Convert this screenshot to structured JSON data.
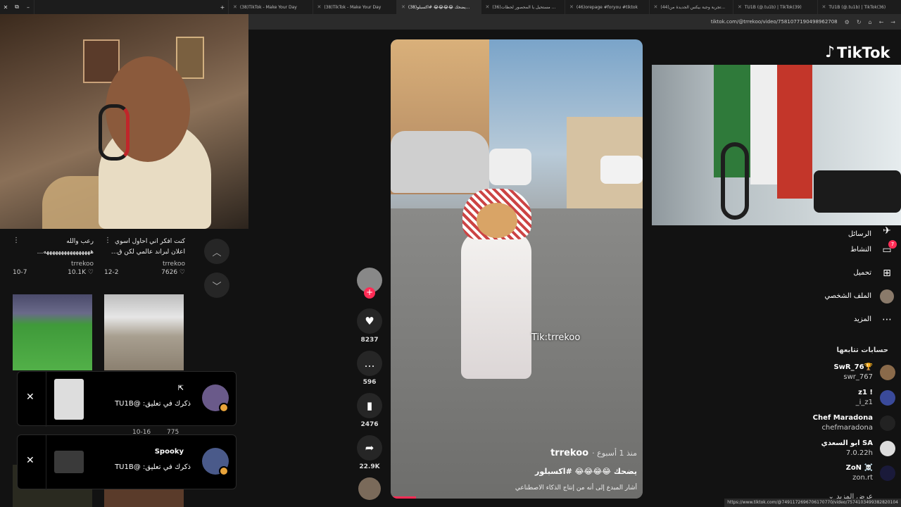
{
  "browser": {
    "tabs": [
      {
        "label": "(38)TikTok - Make Your Day"
      },
      {
        "label": "(38)TikTok - Make Your Day"
      },
      {
        "label": "(38)يضحك 😂😂😂😂 #اكسبلو..."
      },
      {
        "label": "(36)مستحيل يا المحصور لحظات ..."
      },
      {
        "label": "(46)orepage #foryou #tiktok"
      },
      {
        "label": "(44)تجربة وجبة بيكس الجديدة من..."
      },
      {
        "label": "TU1B (@.tu1b) | TikTok(39)"
      },
      {
        "label": "TU1B (@.tu1b) | TikTok(36)"
      }
    ],
    "url": "tiktok.com/@trrekoo/video/7581077190498962708",
    "status_url": "https://www.tiktok.com/@7491172696706170770/video/7574103499382820104"
  },
  "grid": {
    "cards": [
      {
        "caption": "رعب والله",
        "caption2": "ههههههههههههههههه...",
        "author": "trrekoo",
        "likes": "10.1K",
        "date": "10-7"
      },
      {
        "caption": "كنت افكر اني احاول اسوي",
        "caption2": "اعلان لبراند عالمي لكن ق...",
        "author": "trrekoo",
        "likes": "7626",
        "date": "12-2"
      }
    ],
    "hidden_row": {
      "likes": "775",
      "date": "10-16"
    }
  },
  "notifications": [
    {
      "user": "",
      "message": "ذكرك في تعليق: @TU1B"
    },
    {
      "user": "Spooky",
      "message": "ذكرك في تعليق: @TU1B"
    }
  ],
  "actions": {
    "likes": "8237",
    "comments": "596",
    "saves": "2476",
    "shares": "22.9K"
  },
  "video": {
    "watermark": "Tik:trrekoo",
    "author": "trrekoo",
    "time_ago": "· منذ 1 أسبوع",
    "description": "يضحك 😂😂😂😂 #اكسبلور",
    "ai_label": "أشار المبدع إلى أنه من إنتاج الذكاء الاصطناعي",
    "progress": 0.1
  },
  "logo": {
    "text": "TikTok"
  },
  "sidebar": {
    "items": [
      {
        "label": "الرسائل",
        "icon": "messages-icon"
      },
      {
        "label": "النشاط",
        "icon": "activity-icon",
        "badge": "7"
      },
      {
        "label": "تحميل",
        "icon": "upload-icon"
      },
      {
        "label": "الملف الشخصي",
        "icon": "profile-icon"
      },
      {
        "label": "المزيد",
        "icon": "more-icon"
      }
    ],
    "following_header": "حسابات تتابعها",
    "following": [
      {
        "name": "SwR_76🏆",
        "handle": "swr_767"
      },
      {
        "name": "z1 !",
        "handle": "_i_z1"
      },
      {
        "name": "Chef Maradona",
        "handle": "chefmaradona"
      },
      {
        "name": "ابو السعدي SA",
        "handle": "7.0.22h"
      },
      {
        "name": "ZoN ☠️",
        "handle": "zon.rt"
      }
    ],
    "see_more": "عرض المزيد"
  }
}
